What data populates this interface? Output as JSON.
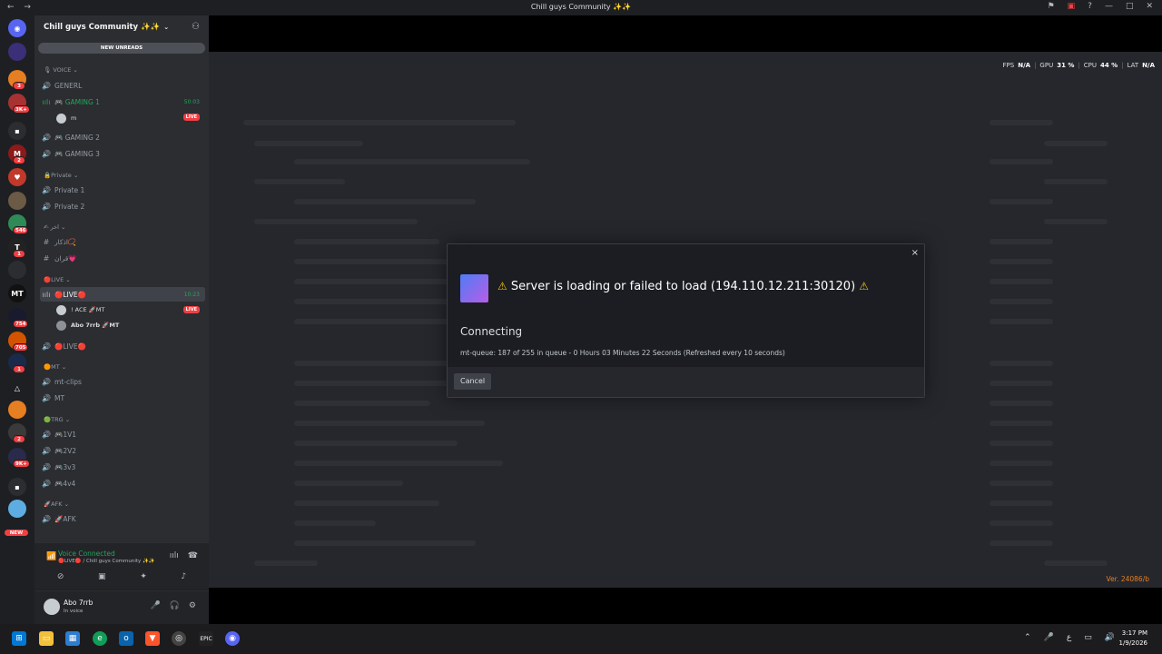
{
  "window": {
    "title": "Chill guys Community ✨✨",
    "nav_back": "←",
    "nav_forward": "→"
  },
  "rail": {
    "servers": [
      {
        "name": "discord-home",
        "label": "◉",
        "color": "#5865f2",
        "badge": ""
      },
      {
        "name": "server-1",
        "label": "",
        "color": "#3a2f78",
        "badge": ""
      },
      {
        "name": "server-2",
        "label": "",
        "color": "#e67e22",
        "badge": "3"
      },
      {
        "name": "server-3",
        "label": "",
        "color": "#a83232",
        "badge": "3K+"
      },
      {
        "name": "folder-1",
        "label": "▪",
        "color": "#2b2d31",
        "badge": ""
      },
      {
        "name": "server-4",
        "label": "M",
        "color": "#8b1a1a",
        "badge": "2"
      },
      {
        "name": "server-5",
        "label": "♥",
        "color": "#c0392b",
        "badge": ""
      },
      {
        "name": "server-6",
        "label": "",
        "color": "#6b5a45",
        "badge": ""
      },
      {
        "name": "server-7",
        "label": "",
        "color": "#2e8b57",
        "badge": "546"
      },
      {
        "name": "server-8",
        "label": "T",
        "color": "#222",
        "badge": "1"
      },
      {
        "name": "server-9",
        "label": "",
        "color": "#2b2d31",
        "badge": ""
      },
      {
        "name": "server-mt",
        "label": "MT",
        "color": "#111",
        "badge": ""
      },
      {
        "name": "server-10",
        "label": "",
        "color": "#1a1a2e",
        "badge": "754"
      },
      {
        "name": "server-11",
        "label": "",
        "color": "#d35400",
        "badge": "705"
      },
      {
        "name": "server-12",
        "label": "",
        "color": "#1a2a4a",
        "badge": "1"
      },
      {
        "name": "server-13",
        "label": "△",
        "color": "#1e1f22",
        "badge": ""
      },
      {
        "name": "server-14",
        "label": "",
        "color": "#e67e22",
        "badge": ""
      },
      {
        "name": "server-15",
        "label": "",
        "color": "#3a3a3a",
        "badge": "2"
      },
      {
        "name": "server-16",
        "label": "",
        "color": "#2a2a4a",
        "badge": "9K+"
      },
      {
        "name": "folder-2",
        "label": "▪",
        "color": "#2b2d31",
        "badge": ""
      },
      {
        "name": "server-17",
        "label": "",
        "color": "#5dade2",
        "badge": ""
      }
    ],
    "new_badge": "NEW"
  },
  "server": {
    "name": "Chill guys Community ✨✨",
    "new_unreads": "NEW UNREADS"
  },
  "channels": {
    "voice_cat": "VOICE",
    "generl": "GENERL",
    "gaming1": "🎮 GAMING 1",
    "gaming1_time": "50:03",
    "gaming1_user": "m",
    "live_badge": "LIVE",
    "gaming2": "🎮 GAMING 2",
    "gaming3": "🎮 GAMING 3",
    "private_cat": "Private",
    "private1": "Private 1",
    "private2": "Private 2",
    "ar_cat": "اخر",
    "ar_ch1": "اذكار📿",
    "ar_ch2": "قران💗",
    "live_cat": "LIVE",
    "live_ch": "🔴LIVE🔴",
    "live_time": "10:23",
    "live_user1": "! ACE 🚀MT",
    "live_user2": "Abo 7rrb 🚀MT",
    "live2_ch": "🔴LIVE🔴",
    "mt_cat": "MT",
    "mt_clips": "mt-clips",
    "mt": "MT",
    "trg_cat": "TRG",
    "v1": "🎮1V1",
    "v2": "🎮2V2",
    "v3": "🎮3v3",
    "v4": "🎮4v4",
    "afk_cat": "AFK",
    "afk": "🚀AFK"
  },
  "voice_panel": {
    "status": "Voice Connected",
    "location": "🔴LIVE🔴 / Chill guys Community ✨✨"
  },
  "user": {
    "name": "Abo 7rrb",
    "status": "In voice"
  },
  "stats": {
    "fps_label": "FPS",
    "fps": "N/A",
    "gpu_label": "GPU",
    "gpu": "31 %",
    "cpu_label": "CPU",
    "cpu": "44 %",
    "lat_label": "LAT",
    "lat": "N/A"
  },
  "version": "Ver. 24086/b",
  "dialog": {
    "close": "×",
    "title": "Server is loading or failed to load (194.110.12.211:30120)",
    "connecting": "Connecting",
    "queue": "mt-queue: 187 of 255 in queue - 0 Hours 03 Minutes 22 Seconds (Refreshed every 10 seconds)",
    "cancel": "Cancel"
  },
  "taskbar": {
    "time": "3:17 PM",
    "date": "1/9/2026",
    "lang": "ع"
  }
}
